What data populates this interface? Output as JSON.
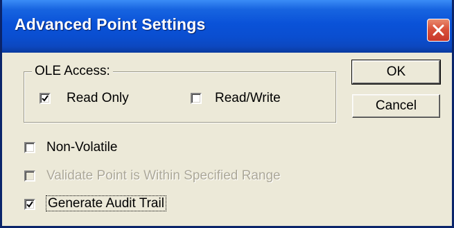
{
  "window": {
    "title": "Advanced Point Settings",
    "title_bar_color": "#0A52D8",
    "close_icon": "close-icon",
    "close_button_color": "#D9513A"
  },
  "ole_access": {
    "group_label": "OLE Access:",
    "read_only": {
      "label": "Read Only",
      "checked": true
    },
    "read_write": {
      "label": "Read/Write",
      "checked": false
    }
  },
  "options": {
    "non_volatile": {
      "label": "Non-Volatile",
      "checked": false,
      "enabled": true
    },
    "validate_range": {
      "label": "Validate Point is Within Specified Range",
      "checked": false,
      "enabled": false
    },
    "audit_trail": {
      "label": "Generate Audit Trail",
      "checked": true,
      "enabled": true
    }
  },
  "buttons": {
    "ok_label": "OK",
    "cancel_label": "Cancel"
  }
}
